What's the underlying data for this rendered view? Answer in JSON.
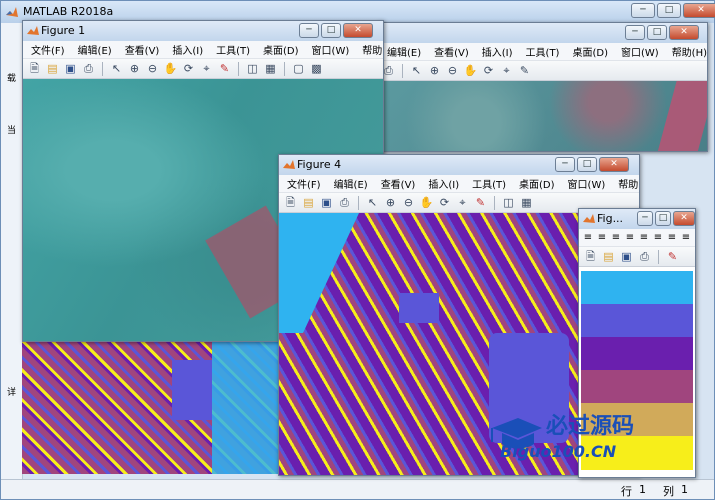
{
  "app": {
    "title": "MATLAB R2018a",
    "status": {
      "row_label": "行",
      "row_value": "1",
      "col_label": "列",
      "col_value": "1"
    },
    "left_panel_chars": [
      "载",
      "当",
      "详"
    ]
  },
  "menu_items": [
    "文件(F)",
    "编辑(E)",
    "查看(V)",
    "插入(I)",
    "工具(T)",
    "桌面(D)",
    "窗口(W)",
    "帮助(H)"
  ],
  "figures": {
    "fig1": {
      "title": "Figure 1"
    },
    "fig4": {
      "title": "Figure 4"
    },
    "fig_small": {
      "title": "Fig..."
    }
  },
  "toolbar_icons": [
    "new-file-icon",
    "open-folder-icon",
    "save-icon",
    "print-icon",
    "pointer-icon",
    "zoom-in-icon",
    "zoom-out-icon",
    "pan-hand-icon",
    "rotate-icon",
    "data-cursor-icon",
    "brush-icon",
    "link-icon",
    "colorbar-icon",
    "legend-icon",
    "hide-plot-tools-icon",
    "show-plot-tools-icon"
  ],
  "watermark": {
    "line1": "必过源码",
    "line2": "Biguo100.CN"
  },
  "colors": {
    "cluster_cyan": "#2fb3f0",
    "cluster_blue": "#5a56d8",
    "cluster_purple": "#6a1fae",
    "cluster_magenta": "#a0457e",
    "cluster_gold": "#d1aa5a",
    "cluster_yellow": "#f7ee1a",
    "teal": "#3f9fa0"
  }
}
